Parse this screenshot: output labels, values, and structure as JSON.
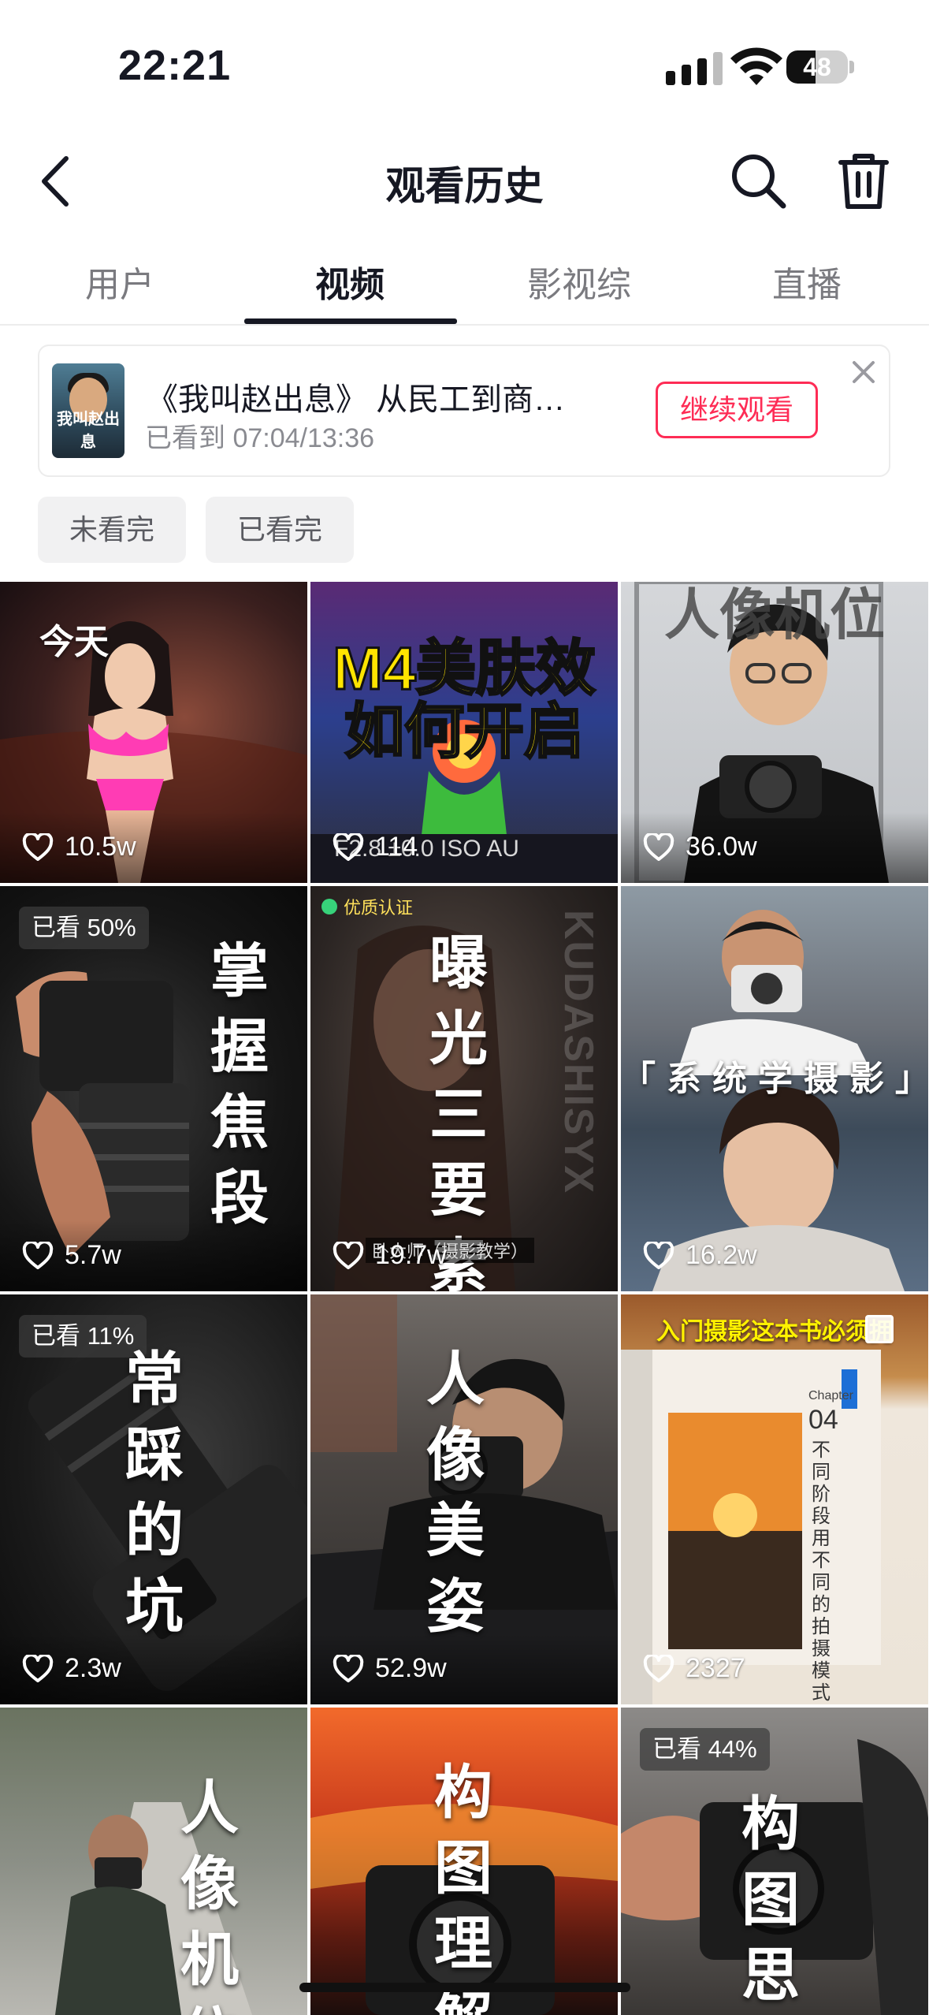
{
  "status_bar": {
    "time": "22:21",
    "battery": "48"
  },
  "header": {
    "title": "观看历史"
  },
  "tabs": [
    {
      "label": "用户"
    },
    {
      "label": "视频"
    },
    {
      "label": "影视综"
    },
    {
      "label": "直播"
    }
  ],
  "continue_card": {
    "title": "《我叫赵出息》 从民工到商…",
    "progress": "已看到 07:04/13:36",
    "button": "继续观看",
    "poster_text": "我叫赵出息"
  },
  "filters": [
    {
      "label": "未看完"
    },
    {
      "label": "已看完"
    }
  ],
  "grid": {
    "section_label": "今天",
    "quality_label": "优质认证",
    "videos": [
      {
        "likes": "10.5w"
      },
      {
        "likes": "114",
        "overlay": "M4美肤效",
        "overlay2": "如何开启",
        "caption": "F2.8  ±0.0  ISO AU"
      },
      {
        "likes": "36.0w",
        "overlay": "人像机位"
      },
      {
        "likes": "5.7w",
        "watched": "已看 50%",
        "overlay": "掌握焦段"
      },
      {
        "likes": "19.7w",
        "overlay": "曝光三要素",
        "caption": "卧大师（摄影教学）",
        "watermark": "KUDASHISYX"
      },
      {
        "likes": "16.2w",
        "overlay": "「系统学摄影」"
      },
      {
        "likes": "2.3w",
        "watched": "已看 11%",
        "overlay": "常踩的坑"
      },
      {
        "likes": "52.9w",
        "overlay": "人像美姿"
      },
      {
        "likes": "2327",
        "overlay": "入门摄影这本书必须拥",
        "chapter": "Chapter",
        "chapter_no": "04",
        "book_text": "不同阶段用不同的拍摄模式"
      },
      {
        "overlay": "人像机位"
      },
      {
        "overlay": "构图理解"
      },
      {
        "watched": "已看 44%",
        "overlay": "构图思维"
      }
    ]
  }
}
